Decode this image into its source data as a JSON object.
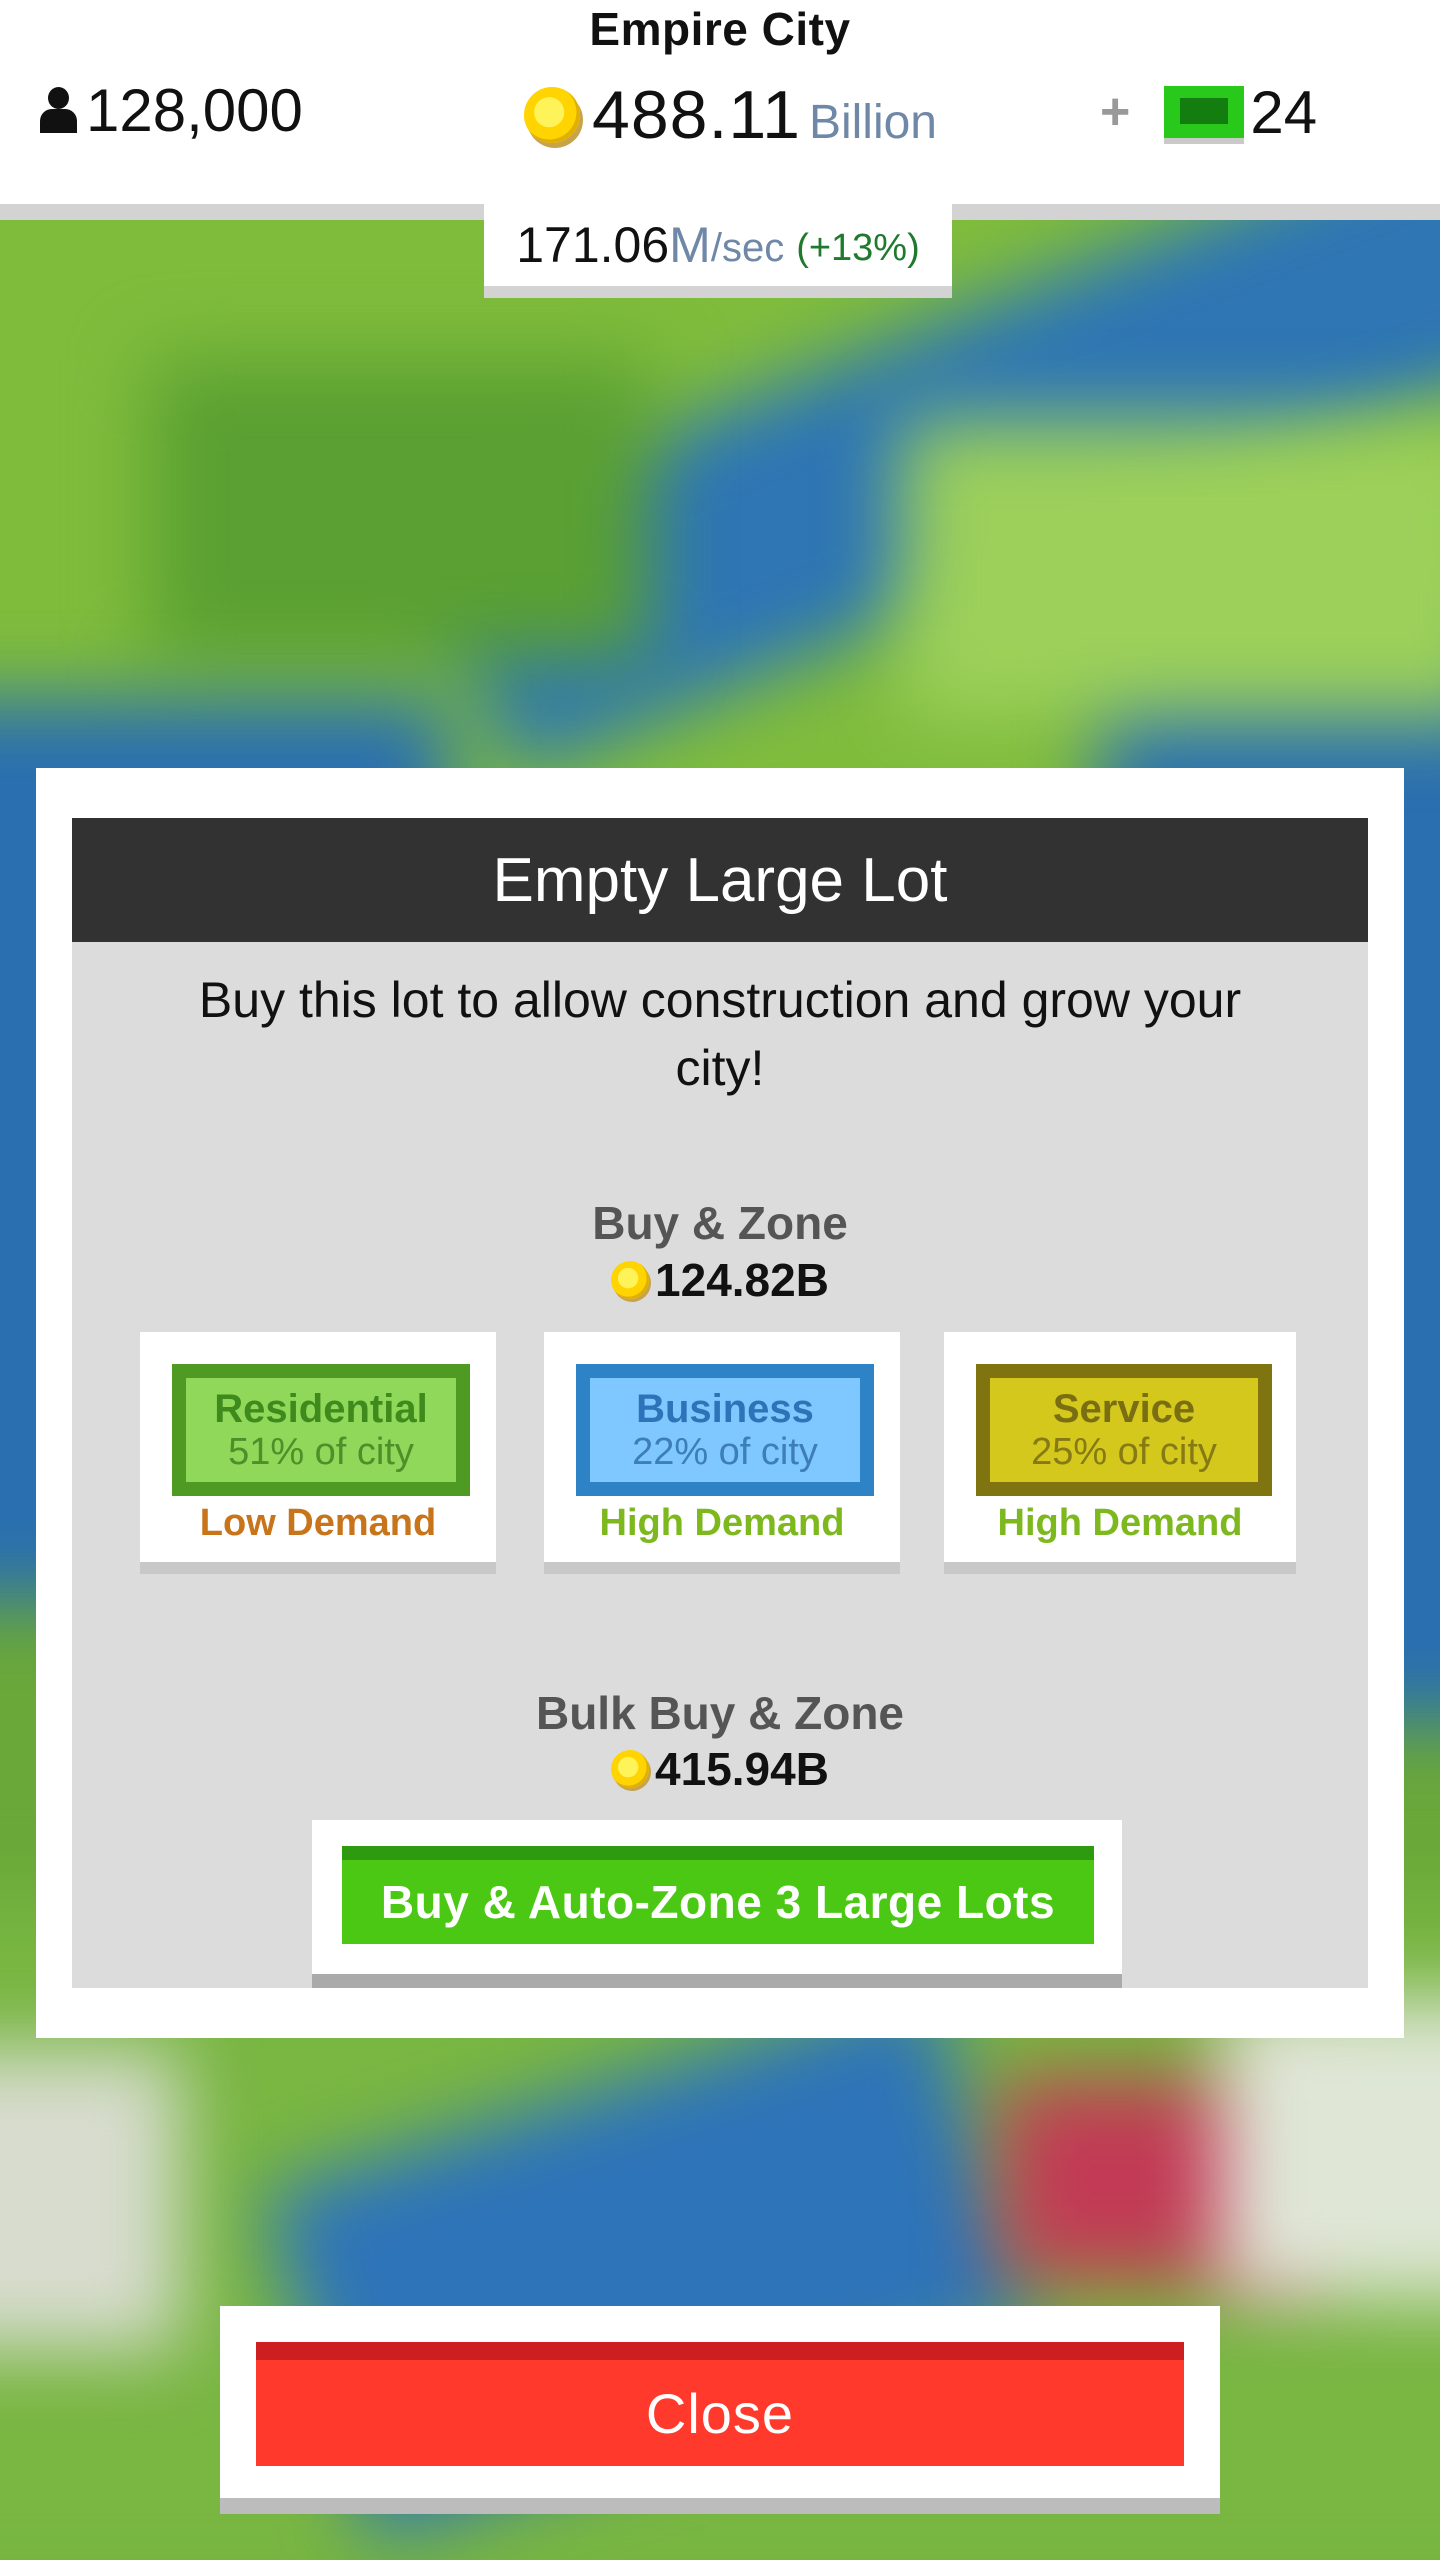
{
  "header": {
    "city_name": "Empire City",
    "population": "128,000",
    "money_amount": "488.11",
    "money_unit": "Billion",
    "add_symbol": "+",
    "cash_count": "24",
    "income_rate": "171.06",
    "income_unit": "M",
    "income_per": "/sec",
    "income_change": "(+13%)"
  },
  "dialog": {
    "title": "Empty Large Lot",
    "description": "Buy this lot to allow construction and grow your city!",
    "buy_zone_label": "Buy & Zone",
    "buy_zone_price": "124.82B",
    "zones": [
      {
        "name": "Residential",
        "share": "51% of city",
        "demand": "Low Demand"
      },
      {
        "name": "Business",
        "share": "22% of city",
        "demand": "High Demand"
      },
      {
        "name": "Service",
        "share": "25% of city",
        "demand": "High Demand"
      }
    ],
    "bulk_label": "Bulk Buy & Zone",
    "bulk_price": "415.94B",
    "bulk_button": "Buy & Auto-Zone 3 Large Lots"
  },
  "close_label": "Close",
  "colors": {
    "residential": "#8fd85a",
    "business": "#7fc8ff",
    "service": "#d4c81c",
    "low_demand": "#c8741a",
    "high_demand": "#7db81e",
    "bulk_button": "#4ac813",
    "close_button": "#ff3a2c"
  },
  "icons": [
    "person-icon",
    "coin-icon",
    "plus-icon",
    "cash-icon"
  ]
}
